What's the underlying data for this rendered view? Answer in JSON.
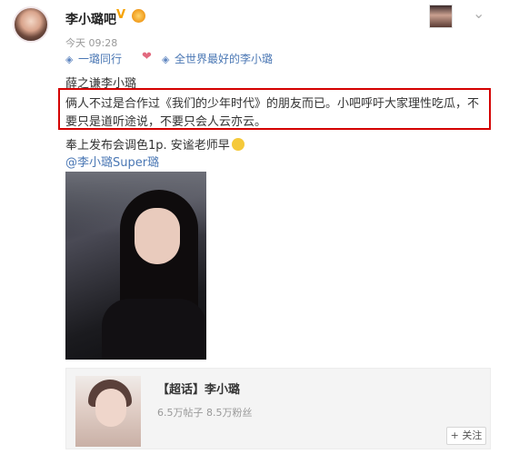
{
  "post": {
    "username": "李小璐吧",
    "verified_mark": "V",
    "time": "今天 09:28",
    "topics": [
      "一璐同行",
      "全世界最好的李小璐"
    ],
    "lines": [
      "薛之谦李小璐",
      "俩人不过是合作过《我们的少年时代》的朋友而已。小吧呼吁大家理性吃瓜，不",
      "要只是道听途说，不要只会人云亦云。",
      "奉上发布会调色1p. 安谧老师早"
    ],
    "mention": "@李小璐Super璐"
  },
  "card": {
    "title": "【超话】李小璐",
    "stats": "6.5万帖子 8.5万粉丝",
    "follow_label": "+ 关注"
  },
  "icons": {
    "topic": "topic-link-icon",
    "heart": "heart-icon",
    "chevron": "chevron-down-icon",
    "smile": "smile-emoji-icon"
  },
  "colors": {
    "highlight_border": "#d40000",
    "link": "#4a77b4",
    "verified": "#f6a200"
  }
}
